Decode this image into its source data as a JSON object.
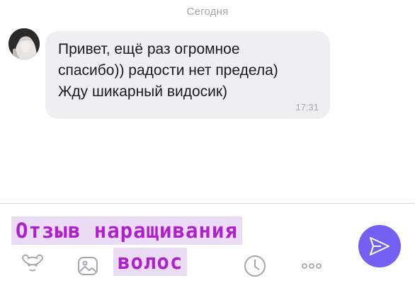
{
  "chat": {
    "date_separator": "Сегодня",
    "message": {
      "text": "Привет, ещё раз огромное\nспасибо)) радости нет предела)\nЖду шикарный видосик)",
      "time": "17:31"
    }
  },
  "composer": {
    "input_value": ""
  },
  "overlay": {
    "line1": "Отзыв наращивания",
    "line2": "волос"
  },
  "toolbar": {
    "icons": [
      "sticker-icon",
      "gallery-icon",
      "clock-icon",
      "more-icon",
      "send-icon"
    ]
  },
  "colors": {
    "accent": "#7360f2",
    "bubble": "#efeff1",
    "icon_gray": "#a6a6ad",
    "overlay_text": "#b01fcf",
    "overlay_bg": "#eadcf5"
  }
}
